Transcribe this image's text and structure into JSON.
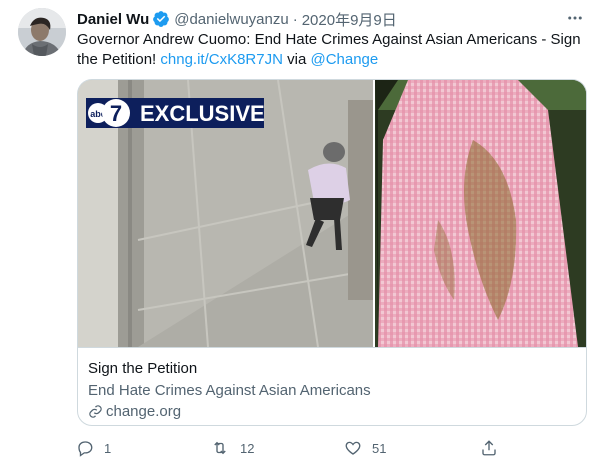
{
  "tweet": {
    "author_name": "Daniel Wu",
    "handle": "@danielwuyanzu",
    "separator": "·",
    "date": "2020年9月9日",
    "text_prefix": "Governor Andrew Cuomo: End Hate Crimes Against Asian Americans - Sign the Petition! ",
    "link_text": "chng.it/CxK8R7JN",
    "via_text": " via ",
    "mention": "@Change"
  },
  "card": {
    "image_overlay_logo": "abc 7",
    "image_overlay_text": "EXCLUSIVE",
    "title": "Sign the Petition",
    "description": "End Hate Crimes Against Asian Americans",
    "domain": "change.org"
  },
  "actions": {
    "reply_count": "1",
    "retweet_count": "12",
    "like_count": "51"
  },
  "icons": {
    "verified": "verified-badge-icon",
    "more": "more-options-icon",
    "reply": "reply-icon",
    "retweet": "retweet-icon",
    "like": "like-icon",
    "share": "share-icon",
    "link": "link-icon"
  },
  "colors": {
    "accent": "#1d9bf0",
    "text_primary": "#0f1419",
    "text_secondary": "#536471",
    "border": "#cfd9de"
  }
}
